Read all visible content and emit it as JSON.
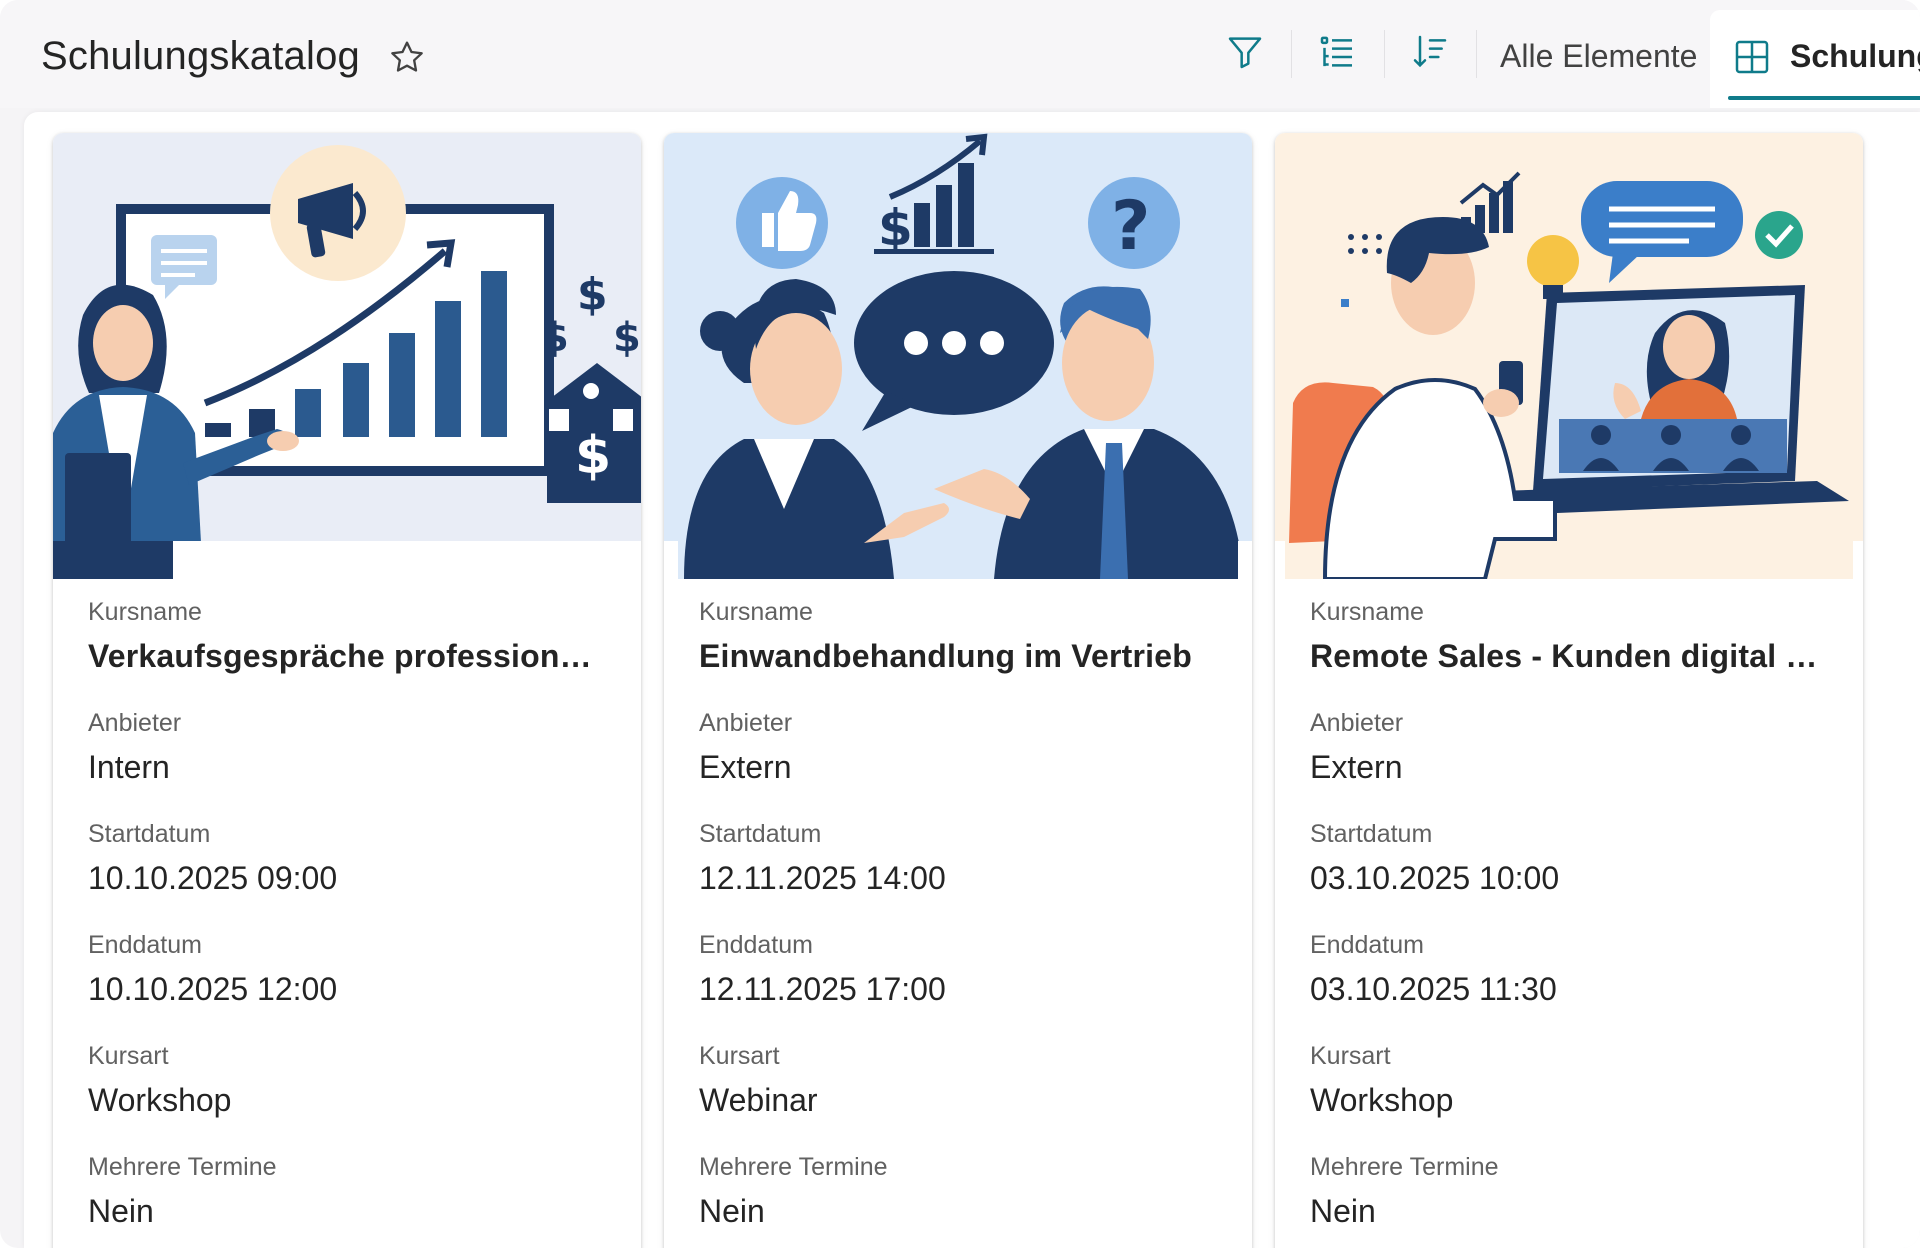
{
  "header": {
    "title": "Schulungskatalog",
    "view_filter_label": "Alle Elemente",
    "active_tab_label": "Schulung"
  },
  "icons": {
    "favorite": "star-outline-icon",
    "filter": "filter-icon",
    "grouping": "list-group-icon",
    "sort": "sort-icon",
    "view": "grid-view-icon"
  },
  "colors": {
    "accent": "#0f7b8a",
    "navy": "#1e3a66"
  },
  "field_labels": {
    "name": "Kursname",
    "provider": "Anbieter",
    "start": "Startdatum",
    "end": "Enddatum",
    "type": "Kursart",
    "multiple": "Mehrere Termine"
  },
  "cards": [
    {
      "name": "Verkaufsgespräche professionell...",
      "provider": "Intern",
      "start": "10.10.2025 09:00",
      "end": "10.10.2025 12:00",
      "type": "Workshop",
      "multiple": "Nein"
    },
    {
      "name": "Einwandbehandlung im Vertrieb",
      "provider": "Extern",
      "start": "12.11.2025 14:00",
      "end": "12.11.2025 17:00",
      "type": "Webinar",
      "multiple": "Nein"
    },
    {
      "name": "Remote Sales - Kunden digital ü...",
      "provider": "Extern",
      "start": "03.10.2025 10:00",
      "end": "03.10.2025 11:30",
      "type": "Workshop",
      "multiple": "Nein"
    }
  ]
}
